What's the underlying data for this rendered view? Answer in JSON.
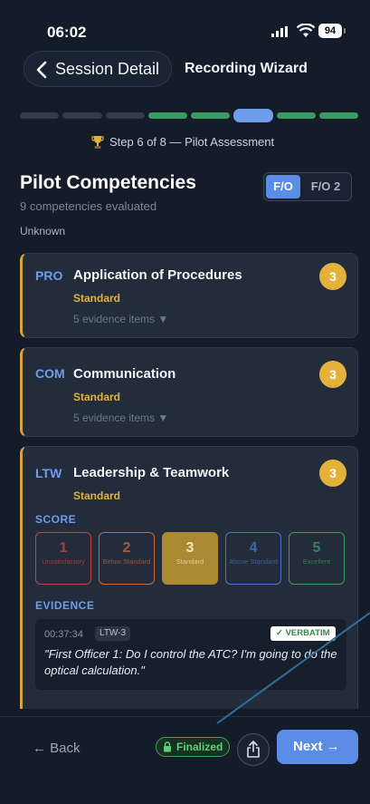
{
  "status": {
    "time": "06:02",
    "battery": "94"
  },
  "nav": {
    "back_label": "Session Detail",
    "title": "Recording Wizard"
  },
  "progress": {
    "current_step": 6,
    "total_steps": 8,
    "label": "Step 6 of 8 — Pilot Assessment"
  },
  "header": {
    "title": "Pilot Competencies",
    "subtitle": "9 competencies evaluated",
    "status_note": "Unknown"
  },
  "pilot_tabs": [
    {
      "label": "F/O",
      "selected": true
    },
    {
      "label": "F/O 2",
      "selected": false
    }
  ],
  "competencies": [
    {
      "code": "PRO",
      "name": "Application of Procedures",
      "rating": "Standard",
      "evidence": "5 evidence items ▼",
      "score": "3"
    },
    {
      "code": "COM",
      "name": "Communication",
      "rating": "Standard",
      "evidence": "5 evidence items ▼",
      "score": "3"
    },
    {
      "code": "LTW",
      "name": "Leadership & Teamwork",
      "rating": "Standard",
      "score": "3"
    }
  ],
  "expanded": {
    "score_label": "SCORE",
    "evidence_label": "EVIDENCE",
    "score_options": [
      {
        "num": "1",
        "label": "Unsatisfactory",
        "color": "#c2444a",
        "selected": false
      },
      {
        "num": "2",
        "label": "Below Standard",
        "color": "#c9683a",
        "selected": false
      },
      {
        "num": "3",
        "label": "Standard",
        "color": "#d9a23a",
        "selected": true
      },
      {
        "num": "4",
        "label": "Above Standard",
        "color": "#4a74c4",
        "selected": false
      },
      {
        "num": "5",
        "label": "Excellent",
        "color": "#3f9a5a",
        "selected": false
      }
    ],
    "evidence_item": {
      "timestamp": "00:37:34",
      "tag": "LTW-3",
      "badge": "✓ VERBATIM",
      "quote": "\"First Officer 1: Do I control the ATC? I'm going to do the optical calculation.\""
    }
  },
  "footer": {
    "back_label": "← Back",
    "finalized_label": "Finalized",
    "next_label": "Next →"
  },
  "colors": {
    "accent": "#5b8ce6",
    "gold": "#e4b23a",
    "green": "#3fa35c",
    "background": "#141c29"
  },
  "icons": [
    "chevron-left-icon",
    "trophy-icon",
    "lock-icon",
    "share-icon",
    "signal-icon",
    "wifi-icon",
    "battery-icon"
  ]
}
